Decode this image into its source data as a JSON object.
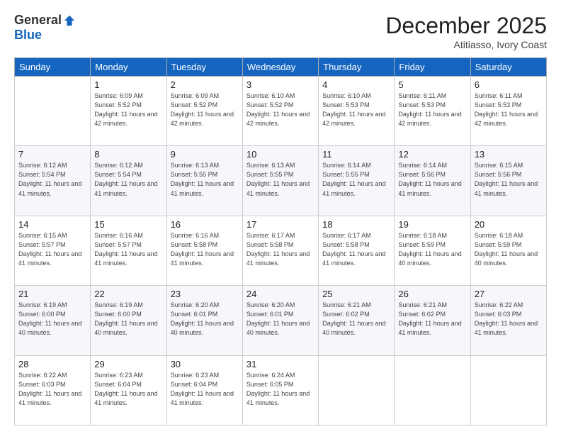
{
  "logo": {
    "general": "General",
    "blue": "Blue"
  },
  "header": {
    "month": "December 2025",
    "location": "Atitiasso, Ivory Coast"
  },
  "weekdays": [
    "Sunday",
    "Monday",
    "Tuesday",
    "Wednesday",
    "Thursday",
    "Friday",
    "Saturday"
  ],
  "weeks": [
    [
      {
        "day": "",
        "sunrise": "",
        "sunset": "",
        "daylight": ""
      },
      {
        "day": "1",
        "sunrise": "Sunrise: 6:09 AM",
        "sunset": "Sunset: 5:52 PM",
        "daylight": "Daylight: 11 hours and 42 minutes."
      },
      {
        "day": "2",
        "sunrise": "Sunrise: 6:09 AM",
        "sunset": "Sunset: 5:52 PM",
        "daylight": "Daylight: 11 hours and 42 minutes."
      },
      {
        "day": "3",
        "sunrise": "Sunrise: 6:10 AM",
        "sunset": "Sunset: 5:52 PM",
        "daylight": "Daylight: 11 hours and 42 minutes."
      },
      {
        "day": "4",
        "sunrise": "Sunrise: 6:10 AM",
        "sunset": "Sunset: 5:53 PM",
        "daylight": "Daylight: 11 hours and 42 minutes."
      },
      {
        "day": "5",
        "sunrise": "Sunrise: 6:11 AM",
        "sunset": "Sunset: 5:53 PM",
        "daylight": "Daylight: 11 hours and 42 minutes."
      },
      {
        "day": "6",
        "sunrise": "Sunrise: 6:11 AM",
        "sunset": "Sunset: 5:53 PM",
        "daylight": "Daylight: 11 hours and 42 minutes."
      }
    ],
    [
      {
        "day": "7",
        "sunrise": "Sunrise: 6:12 AM",
        "sunset": "Sunset: 5:54 PM",
        "daylight": "Daylight: 11 hours and 41 minutes."
      },
      {
        "day": "8",
        "sunrise": "Sunrise: 6:12 AM",
        "sunset": "Sunset: 5:54 PM",
        "daylight": "Daylight: 11 hours and 41 minutes."
      },
      {
        "day": "9",
        "sunrise": "Sunrise: 6:13 AM",
        "sunset": "Sunset: 5:55 PM",
        "daylight": "Daylight: 11 hours and 41 minutes."
      },
      {
        "day": "10",
        "sunrise": "Sunrise: 6:13 AM",
        "sunset": "Sunset: 5:55 PM",
        "daylight": "Daylight: 11 hours and 41 minutes."
      },
      {
        "day": "11",
        "sunrise": "Sunrise: 6:14 AM",
        "sunset": "Sunset: 5:55 PM",
        "daylight": "Daylight: 11 hours and 41 minutes."
      },
      {
        "day": "12",
        "sunrise": "Sunrise: 6:14 AM",
        "sunset": "Sunset: 5:56 PM",
        "daylight": "Daylight: 11 hours and 41 minutes."
      },
      {
        "day": "13",
        "sunrise": "Sunrise: 6:15 AM",
        "sunset": "Sunset: 5:56 PM",
        "daylight": "Daylight: 11 hours and 41 minutes."
      }
    ],
    [
      {
        "day": "14",
        "sunrise": "Sunrise: 6:15 AM",
        "sunset": "Sunset: 5:57 PM",
        "daylight": "Daylight: 11 hours and 41 minutes."
      },
      {
        "day": "15",
        "sunrise": "Sunrise: 6:16 AM",
        "sunset": "Sunset: 5:57 PM",
        "daylight": "Daylight: 11 hours and 41 minutes."
      },
      {
        "day": "16",
        "sunrise": "Sunrise: 6:16 AM",
        "sunset": "Sunset: 5:58 PM",
        "daylight": "Daylight: 11 hours and 41 minutes."
      },
      {
        "day": "17",
        "sunrise": "Sunrise: 6:17 AM",
        "sunset": "Sunset: 5:58 PM",
        "daylight": "Daylight: 11 hours and 41 minutes."
      },
      {
        "day": "18",
        "sunrise": "Sunrise: 6:17 AM",
        "sunset": "Sunset: 5:58 PM",
        "daylight": "Daylight: 11 hours and 41 minutes."
      },
      {
        "day": "19",
        "sunrise": "Sunrise: 6:18 AM",
        "sunset": "Sunset: 5:59 PM",
        "daylight": "Daylight: 11 hours and 40 minutes."
      },
      {
        "day": "20",
        "sunrise": "Sunrise: 6:18 AM",
        "sunset": "Sunset: 5:59 PM",
        "daylight": "Daylight: 11 hours and 40 minutes."
      }
    ],
    [
      {
        "day": "21",
        "sunrise": "Sunrise: 6:19 AM",
        "sunset": "Sunset: 6:00 PM",
        "daylight": "Daylight: 11 hours and 40 minutes."
      },
      {
        "day": "22",
        "sunrise": "Sunrise: 6:19 AM",
        "sunset": "Sunset: 6:00 PM",
        "daylight": "Daylight: 11 hours and 40 minutes."
      },
      {
        "day": "23",
        "sunrise": "Sunrise: 6:20 AM",
        "sunset": "Sunset: 6:01 PM",
        "daylight": "Daylight: 11 hours and 40 minutes."
      },
      {
        "day": "24",
        "sunrise": "Sunrise: 6:20 AM",
        "sunset": "Sunset: 6:01 PM",
        "daylight": "Daylight: 11 hours and 40 minutes."
      },
      {
        "day": "25",
        "sunrise": "Sunrise: 6:21 AM",
        "sunset": "Sunset: 6:02 PM",
        "daylight": "Daylight: 11 hours and 40 minutes."
      },
      {
        "day": "26",
        "sunrise": "Sunrise: 6:21 AM",
        "sunset": "Sunset: 6:02 PM",
        "daylight": "Daylight: 11 hours and 41 minutes."
      },
      {
        "day": "27",
        "sunrise": "Sunrise: 6:22 AM",
        "sunset": "Sunset: 6:03 PM",
        "daylight": "Daylight: 11 hours and 41 minutes."
      }
    ],
    [
      {
        "day": "28",
        "sunrise": "Sunrise: 6:22 AM",
        "sunset": "Sunset: 6:03 PM",
        "daylight": "Daylight: 11 hours and 41 minutes."
      },
      {
        "day": "29",
        "sunrise": "Sunrise: 6:23 AM",
        "sunset": "Sunset: 6:04 PM",
        "daylight": "Daylight: 11 hours and 41 minutes."
      },
      {
        "day": "30",
        "sunrise": "Sunrise: 6:23 AM",
        "sunset": "Sunset: 6:04 PM",
        "daylight": "Daylight: 11 hours and 41 minutes."
      },
      {
        "day": "31",
        "sunrise": "Sunrise: 6:24 AM",
        "sunset": "Sunset: 6:05 PM",
        "daylight": "Daylight: 11 hours and 41 minutes."
      },
      {
        "day": "",
        "sunrise": "",
        "sunset": "",
        "daylight": ""
      },
      {
        "day": "",
        "sunrise": "",
        "sunset": "",
        "daylight": ""
      },
      {
        "day": "",
        "sunrise": "",
        "sunset": "",
        "daylight": ""
      }
    ]
  ]
}
